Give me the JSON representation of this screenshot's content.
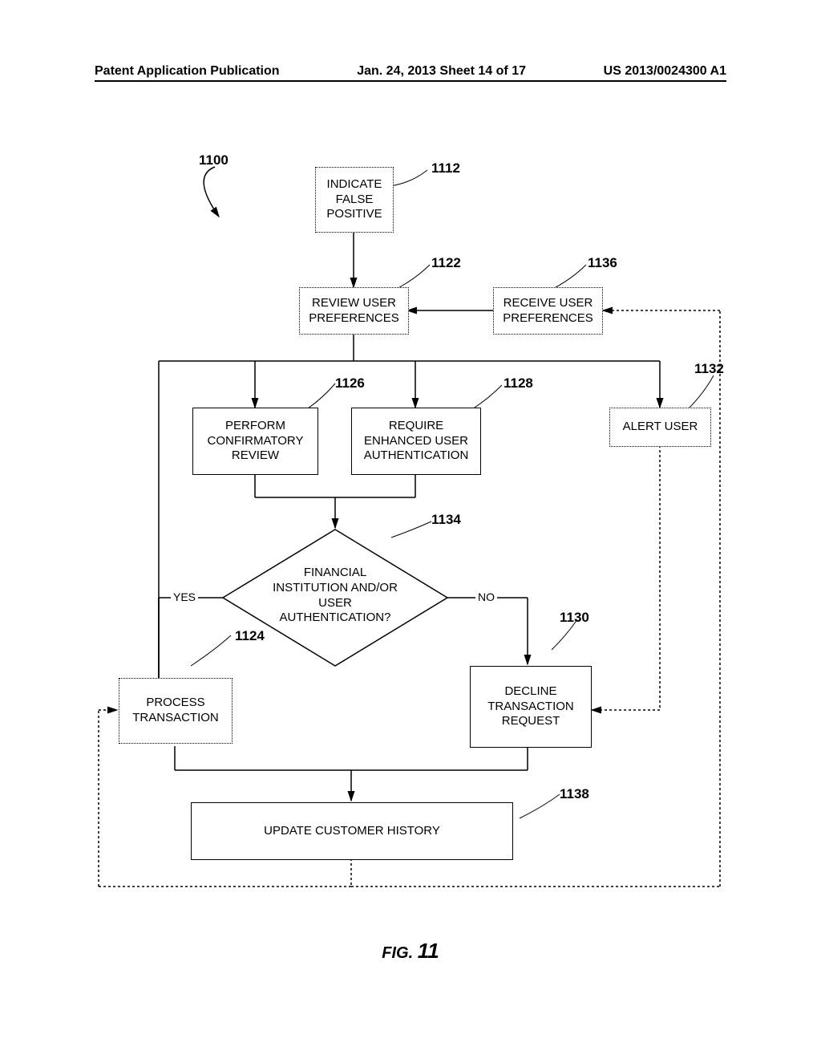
{
  "header": {
    "left": "Patent Application Publication",
    "center": "Jan. 24, 2013  Sheet 14 of 17",
    "right": "US 2013/0024300 A1"
  },
  "refs": {
    "r1100": "1100",
    "r1112": "1112",
    "r1122": "1122",
    "r1136": "1136",
    "r1126": "1126",
    "r1128": "1128",
    "r1132": "1132",
    "r1134": "1134",
    "r1124": "1124",
    "r1130": "1130",
    "r1138": "1138"
  },
  "boxes": {
    "indicate": "INDICATE\nFALSE\nPOSITIVE",
    "reviewPrefs": "REVIEW USER\nPREFERENCES",
    "receivePrefs": "RECEIVE USER\nPREFERENCES",
    "confirmatory": "PERFORM\nCONFIRMATORY\nREVIEW",
    "requireAuth": "REQUIRE\nENHANCED USER\nAUTHENTICATION",
    "alert": "ALERT USER",
    "decision": "FINANCIAL\nINSTITUTION AND/OR\nUSER\nAUTHENTICATION?",
    "process": "PROCESS\nTRANSACTION",
    "decline": "DECLINE\nTRANSACTION\nREQUEST",
    "update": "UPDATE CUSTOMER HISTORY"
  },
  "labels": {
    "yes": "YES",
    "no": "NO"
  },
  "figure": {
    "caption": "FIG.",
    "number": "11"
  }
}
